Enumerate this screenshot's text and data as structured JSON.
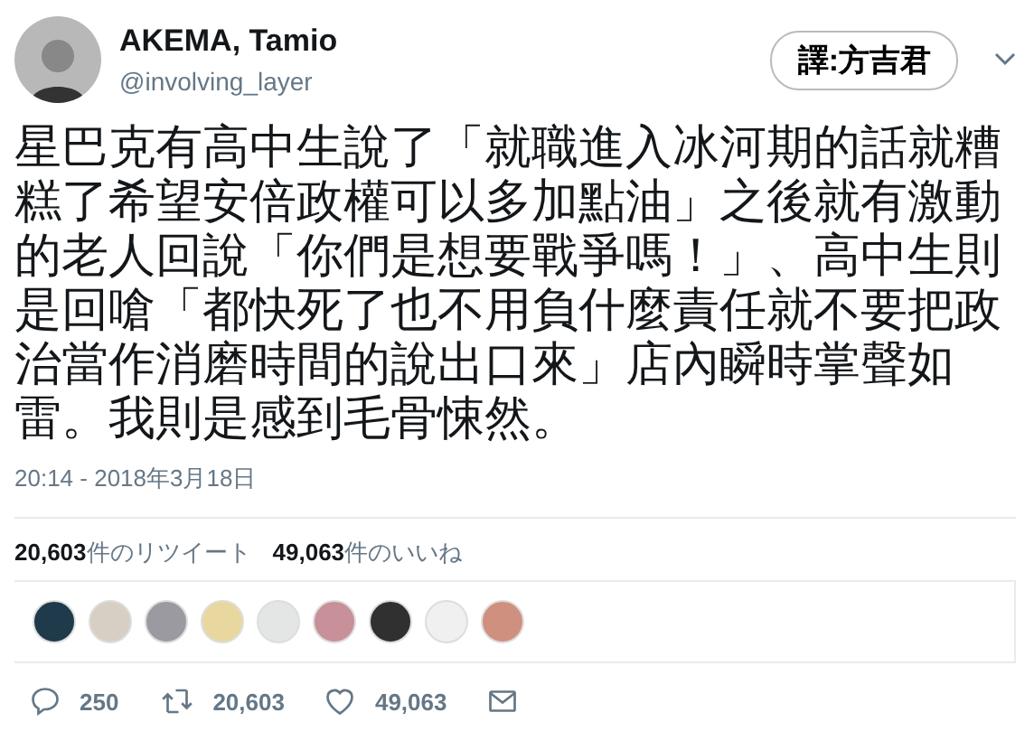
{
  "author": {
    "name": "AKEMA, Tamio",
    "handle": "@involving_layer"
  },
  "badge": "譯:方吉君",
  "tweet": {
    "text": "星巴克有高中生說了「就職進入冰河期的話就糟糕了希望安倍政權可以多加點油」之後就有激動的老人回說「你們是想要戰爭嗎！」、高中生則是回嗆「都快死了也不用負什麼責任就不要把政治當作消磨時間的說出口來」店內瞬時掌聲如雷。我則是感到毛骨悚然。",
    "time": "20:14 - 2018年3月18日"
  },
  "stats": [
    {
      "count": "20,603",
      "label": "件のリツイート"
    },
    {
      "count": "49,063",
      "label": "件のいいね"
    }
  ],
  "likers": [
    {
      "color": "#1f3a4a"
    },
    {
      "color": "#d8cfc4"
    },
    {
      "color": "#9a9aa0"
    },
    {
      "color": "#e8d8a0"
    },
    {
      "color": "#e4e6e6"
    },
    {
      "color": "#c89098"
    },
    {
      "color": "#303030"
    },
    {
      "color": "#f0f0f0"
    },
    {
      "color": "#d09080"
    }
  ],
  "actions": [
    {
      "kind": "reply",
      "count": "250"
    },
    {
      "kind": "retweet",
      "count": "20,603"
    },
    {
      "kind": "like",
      "count": "49,063"
    },
    {
      "kind": "message"
    }
  ]
}
